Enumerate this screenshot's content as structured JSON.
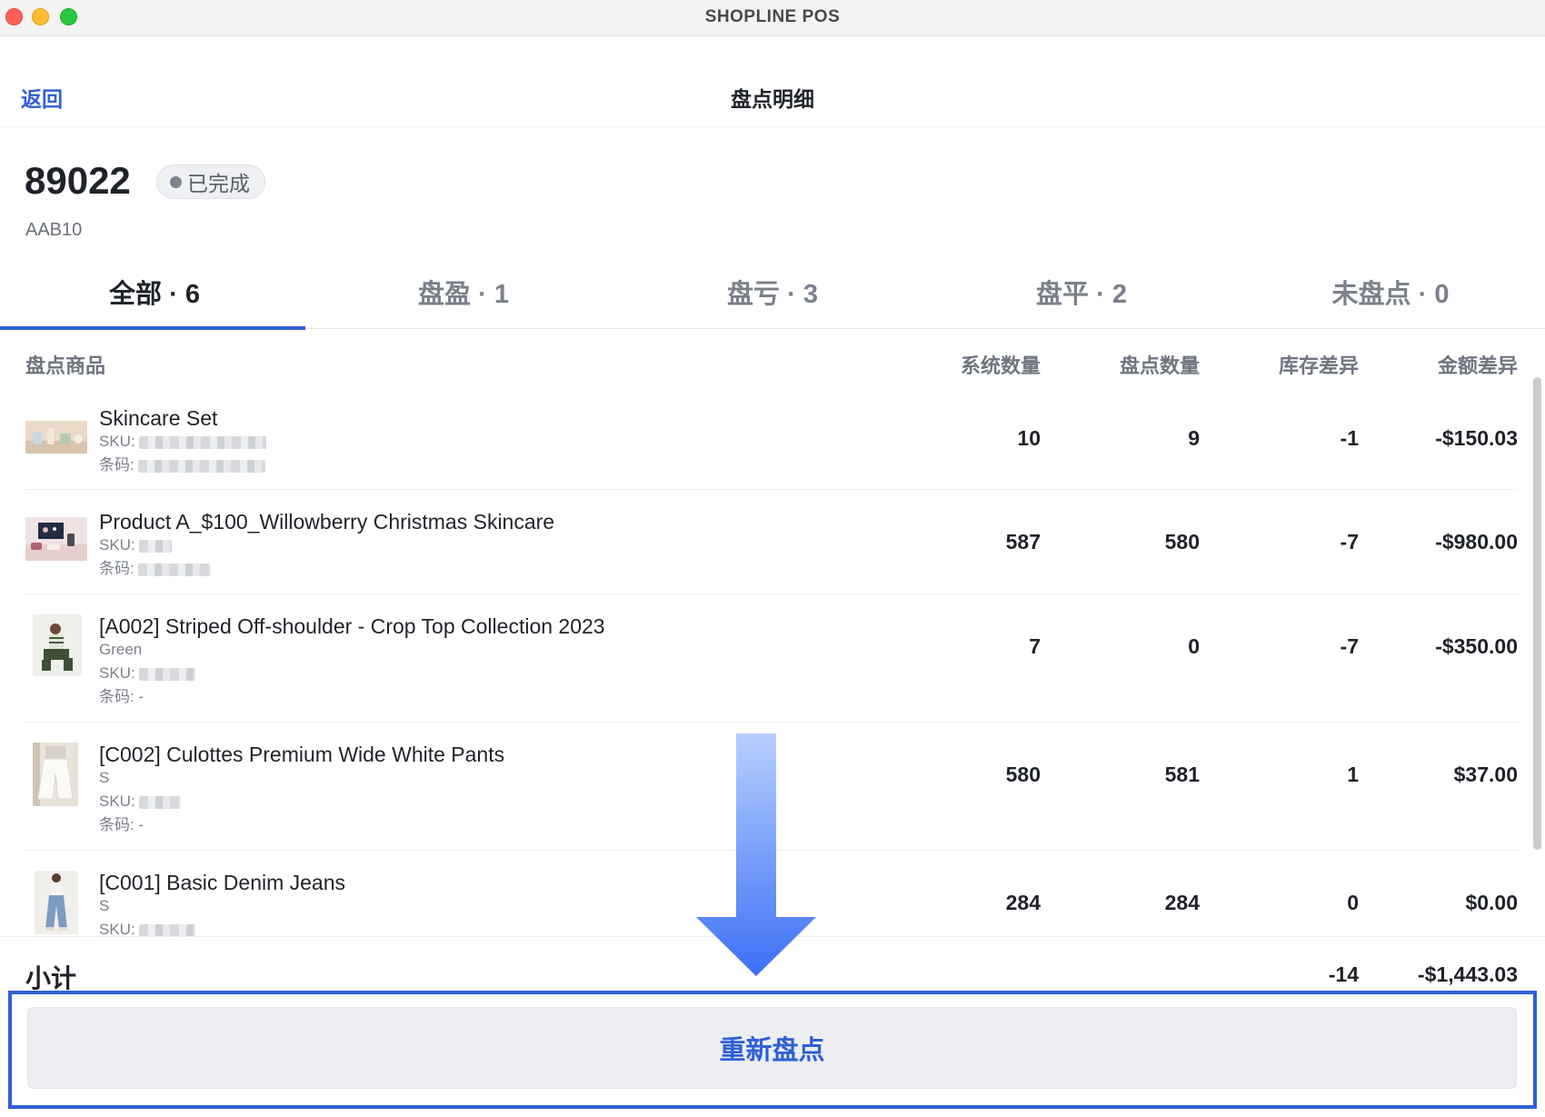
{
  "window": {
    "title": "SHOPLINE POS"
  },
  "nav": {
    "back_label": "返回",
    "title": "盘点明细"
  },
  "order": {
    "number": "89022",
    "status": "已完成",
    "store_code": "AAB10"
  },
  "tabs": [
    {
      "label": "全部 · 6",
      "active": true
    },
    {
      "label": "盘盈 · 1",
      "active": false
    },
    {
      "label": "盘亏 · 3",
      "active": false
    },
    {
      "label": "盘平 · 2",
      "active": false
    },
    {
      "label": "未盘点 · 0",
      "active": false
    }
  ],
  "columns": {
    "product": "盘点商品",
    "system_qty": "系统数量",
    "counted_qty": "盘点数量",
    "stock_diff": "库存差异",
    "amount_diff": "金额差异"
  },
  "labels": {
    "sku": "SKU:",
    "barcode": "条码:"
  },
  "items": [
    {
      "name": "Skincare Set",
      "variant": "",
      "barcode": "",
      "system_qty": "10",
      "counted_qty": "9",
      "stock_diff": "-1",
      "amount_diff": "-$150.03"
    },
    {
      "name": "Product A_$100_Willowberry Christmas Skincare",
      "variant": "",
      "barcode": "",
      "system_qty": "587",
      "counted_qty": "580",
      "stock_diff": "-7",
      "amount_diff": "-$980.00"
    },
    {
      "name": "[A002] Striped Off-shoulder - Crop Top Collection 2023",
      "variant": "Green",
      "barcode": "-",
      "system_qty": "7",
      "counted_qty": "0",
      "stock_diff": "-7",
      "amount_diff": "-$350.00"
    },
    {
      "name": "[C002] Culottes Premium Wide White Pants",
      "variant": "S",
      "barcode": "-",
      "system_qty": "580",
      "counted_qty": "581",
      "stock_diff": "1",
      "amount_diff": "$37.00"
    },
    {
      "name": "[C001] Basic Denim Jeans",
      "variant": "S",
      "barcode": "",
      "system_qty": "284",
      "counted_qty": "284",
      "stock_diff": "0",
      "amount_diff": "$0.00"
    }
  ],
  "subtotal": {
    "label": "小计",
    "stock_diff": "-14",
    "amount_diff": "-$1,443.03"
  },
  "actions": {
    "recount_label": "重新盘点"
  },
  "colors": {
    "accent": "#2f5fd6",
    "arrow": "#3d6ff5"
  }
}
